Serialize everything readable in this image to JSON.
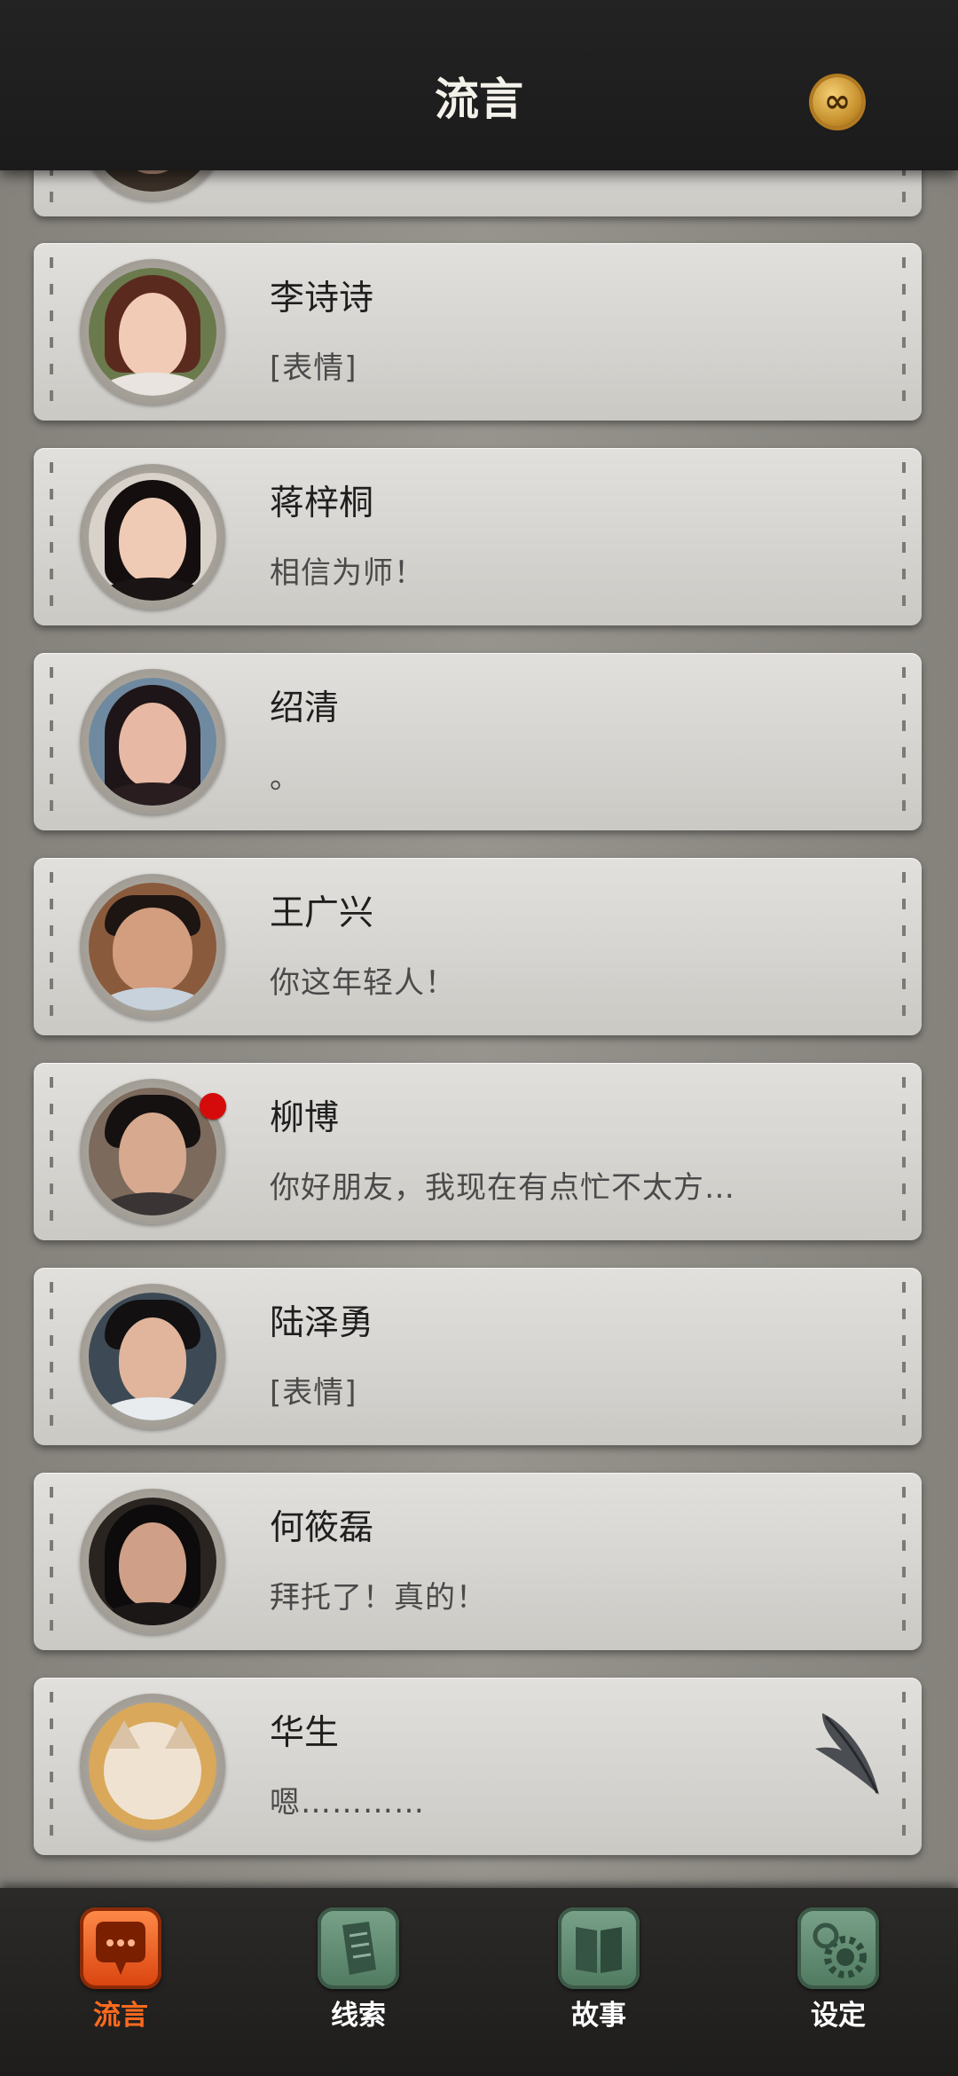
{
  "header": {
    "title": "流言",
    "badge_icon": "infinity-coin-icon",
    "badge_symbol": "∞"
  },
  "conversations": [
    {
      "name": "",
      "message": "",
      "partial": true
    },
    {
      "name": "李诗诗",
      "message": "[表情]"
    },
    {
      "name": "蒋梓桐",
      "message": "相信为师！"
    },
    {
      "name": "绍清",
      "message": "。"
    },
    {
      "name": "王广兴",
      "message": "你这年轻人！"
    },
    {
      "name": "柳博",
      "message": "你好朋友，我现在有点忙不太方…",
      "unread": true
    },
    {
      "name": "陆泽勇",
      "message": "[表情]"
    },
    {
      "name": "何筱磊",
      "message": "拜托了！真的！"
    },
    {
      "name": "华生",
      "message": "嗯…………",
      "icon": "quill-feather-icon"
    }
  ],
  "bottom_nav": {
    "items": [
      {
        "label": "流言",
        "icon": "speech-bubble-icon",
        "active": true
      },
      {
        "label": "线索",
        "icon": "document-icon",
        "active": false
      },
      {
        "label": "故事",
        "icon": "book-icon",
        "active": false
      },
      {
        "label": "设定",
        "icon": "gear-icon",
        "active": false
      }
    ]
  },
  "colors": {
    "accent_active": "#ff6a1e",
    "unread_dot": "#d50b0b",
    "header_bg": "#1e1e1e",
    "nav_icon_green": "#5f8a70"
  }
}
